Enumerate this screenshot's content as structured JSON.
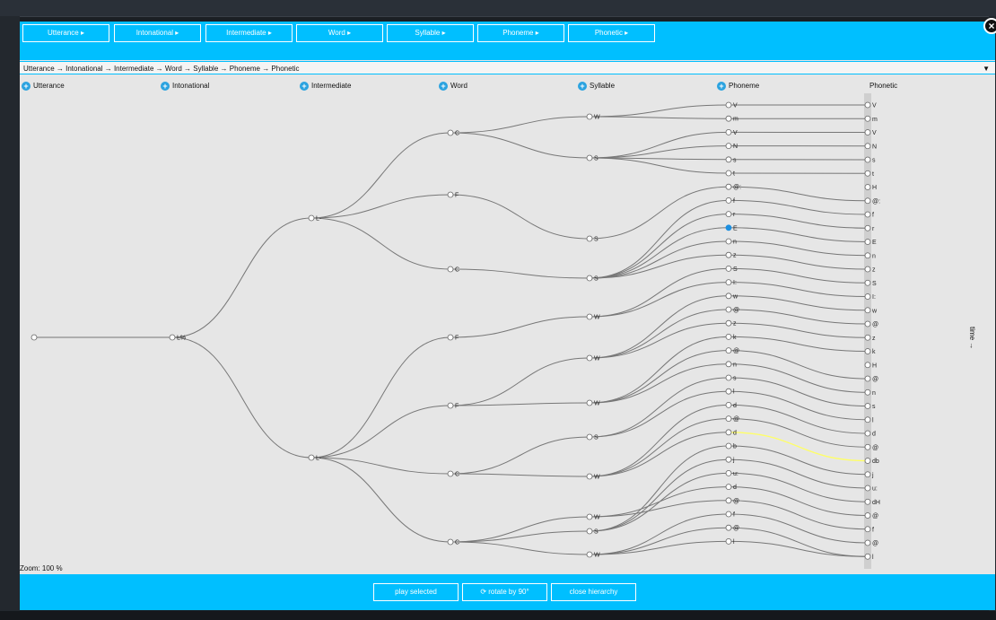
{
  "levels": [
    {
      "label": "Utterance",
      "button_label": "Utterance ▸"
    },
    {
      "label": "Intonational",
      "button_label": "Intonational ▸"
    },
    {
      "label": "Intermediate",
      "button_label": "Intermediate ▸"
    },
    {
      "label": "Word",
      "button_label": "Word ▸"
    },
    {
      "label": "Syllable",
      "button_label": "Syllable ▸"
    },
    {
      "label": "Phoneme",
      "button_label": "Phoneme ▸"
    },
    {
      "label": "Phonetic",
      "button_label": "Phonetic ▸"
    }
  ],
  "path_select": {
    "value": "Utterance → Intonational → Intermediate → Word → Syllable → Phoneme → Phonetic"
  },
  "close_icon": "close-icon",
  "footer": {
    "play_label": "play selected",
    "rotate_label": "⟳ rotate by 90°",
    "close_label": "close hierarchy"
  },
  "zoom_label": "Zoom: 100 %",
  "time_label": "time →",
  "colors": {
    "accent": "#00bfff",
    "link": "#777777",
    "highlight": "#ffff66",
    "selected": "#1e90e0",
    "panel": "#e6e6e6"
  },
  "tree": {
    "utterance": [
      {
        "label": ""
      }
    ],
    "intonational": [
      {
        "label": "L%"
      }
    ],
    "intermediate": [
      {
        "label": "L-"
      },
      {
        "label": "L-"
      }
    ],
    "word": [
      {
        "label": "C"
      },
      {
        "label": "F"
      },
      {
        "label": "C"
      },
      {
        "label": "F"
      },
      {
        "label": "F"
      },
      {
        "label": "C"
      },
      {
        "label": "C"
      }
    ],
    "syllable": [
      {
        "label": "W"
      },
      {
        "label": "S"
      },
      {
        "label": "S"
      },
      {
        "label": "S"
      },
      {
        "label": "W"
      },
      {
        "label": "W"
      },
      {
        "label": "W"
      },
      {
        "label": "S"
      },
      {
        "label": "W"
      },
      {
        "label": "S"
      },
      {
        "label": "W"
      },
      {
        "label": "W"
      }
    ],
    "phoneme": [
      "V",
      "m",
      "V",
      "N",
      "s",
      "t",
      "@:",
      "f",
      "r",
      "E",
      "n",
      "z",
      "S",
      "I:",
      "w",
      "@",
      "z",
      "k",
      "@",
      "n",
      "s",
      "l",
      "d",
      "@",
      "d",
      "b",
      "j",
      "u:",
      "d",
      "@",
      "f",
      "@",
      "l"
    ],
    "phonetic": [
      "V",
      "m",
      "V",
      "N",
      "s",
      "t",
      "H",
      "@:",
      "f",
      "r",
      "E",
      "n",
      "z",
      "S",
      "I:",
      "w",
      "@",
      "z",
      "k",
      "H",
      "@",
      "n",
      "s",
      "l",
      "d",
      "@",
      "db",
      "j",
      "u:",
      "dH",
      "@",
      "f",
      "@",
      "l"
    ],
    "selected_phoneme": 9
  }
}
